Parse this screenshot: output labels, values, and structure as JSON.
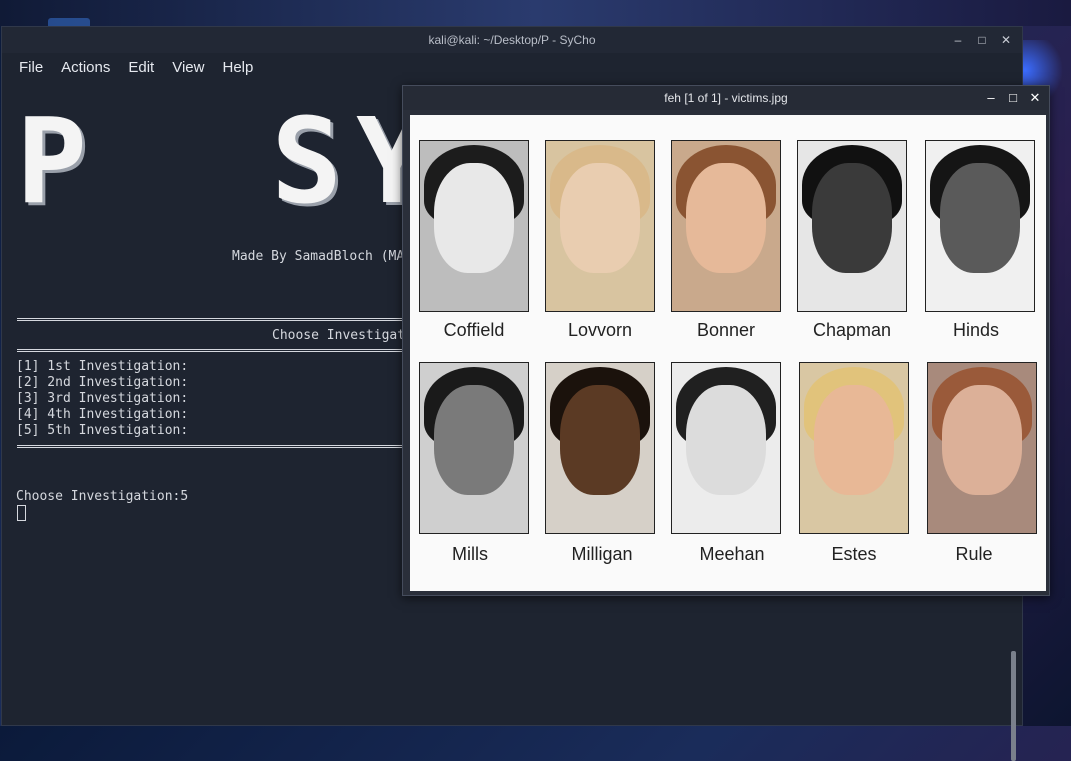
{
  "terminal": {
    "title": "kali@kali: ~/Desktop/P - SyCho",
    "menu": [
      "File",
      "Actions",
      "Edit",
      "View",
      "Help"
    ],
    "banner": "P  SYC",
    "made_by": "Made By SamadBloch (MA",
    "choose_header": "Choose Investigati",
    "options": [
      "[1] 1st Investigation:",
      "[2] 2nd Investigation:",
      "[3] 3rd Investigation:",
      "[4] 4th Investigation:",
      "[5] 5th Investigation:"
    ],
    "prompt": "Choose Investigation:5"
  },
  "feh": {
    "title": "feh [1 of 1] - victims.jpg",
    "row1": [
      "Coffield",
      "Lovvorn",
      "Bonner",
      "Chapman",
      "Hinds"
    ],
    "row2": [
      "Mills",
      "Milligan",
      "Meehan",
      "Estes",
      "Rule"
    ]
  },
  "window_controls": {
    "minimize": "–",
    "maximize": "□",
    "close": "✕"
  }
}
